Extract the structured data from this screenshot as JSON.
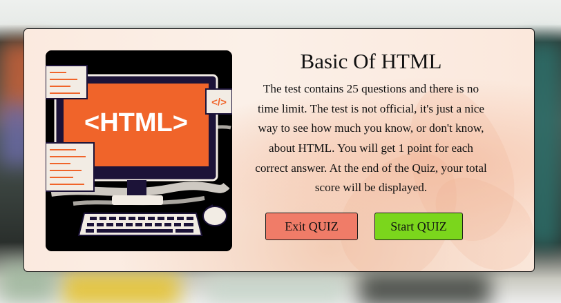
{
  "dialog": {
    "title": "Basic Of HTML",
    "description": "The test contains 25 questions and there is no time limit. The test is not official, it's just a nice way to see how much you know, or don't know, about HTML. You will get 1 point for each correct answer. At the end of the Quiz, your total score will be displayed.",
    "image": {
      "screen_text": "<HTML>",
      "code_badge": "</>"
    },
    "buttons": {
      "exit_label": "Exit QUIZ",
      "start_label": "Start QUIZ"
    }
  },
  "colors": {
    "exit_button": "#f07c68",
    "start_button": "#7bd61c",
    "screen_orange": "#f0642a",
    "monitor_dark": "#1c1338"
  },
  "icons": [
    "computer-illustration",
    "code-icon",
    "keyboard-icon",
    "mouse-icon"
  ]
}
